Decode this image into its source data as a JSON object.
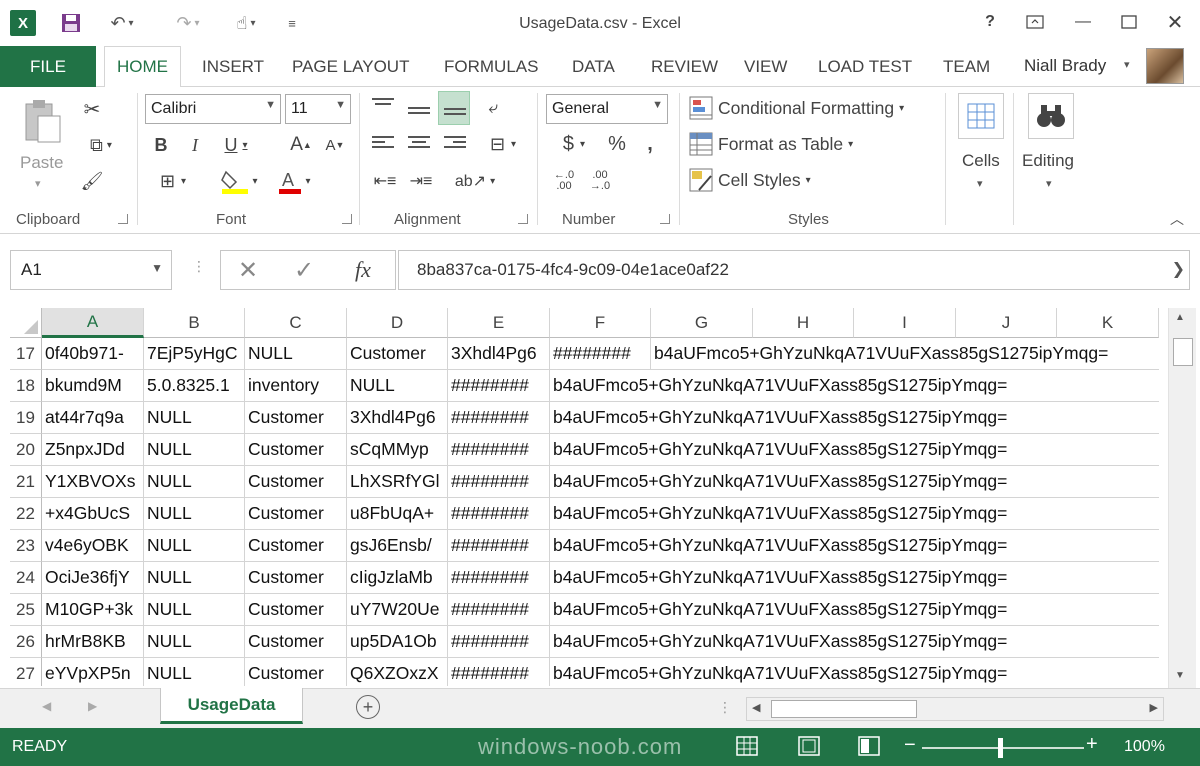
{
  "window": {
    "title": "UsageData.csv - Excel"
  },
  "colors": {
    "accent": "#217346",
    "selection": "#217346"
  },
  "icons": {
    "app": "excel-logo-icon",
    "save": "save-icon",
    "undo": "undo-icon",
    "redo": "redo-icon",
    "touch": "touch-mode-icon",
    "customize": "customize-qat-icon"
  },
  "ribbon_tabs": {
    "file": "FILE",
    "items": [
      "HOME",
      "INSERT",
      "PAGE LAYOUT",
      "FORMULAS",
      "DATA",
      "REVIEW",
      "VIEW",
      "LOAD TEST",
      "TEAM"
    ],
    "active": "HOME"
  },
  "user": {
    "name": "Niall Brady"
  },
  "ribbon": {
    "clipboard": {
      "label": "Clipboard",
      "paste": "Paste"
    },
    "font": {
      "label": "Font",
      "family": "Calibri",
      "size": "11"
    },
    "alignment": {
      "label": "Alignment"
    },
    "number": {
      "label": "Number",
      "format": "General"
    },
    "styles": {
      "label": "Styles",
      "conditional_formatting": "Conditional Formatting",
      "format_as_table": "Format as Table",
      "cell_styles": "Cell Styles"
    },
    "cells": {
      "label": "Cells"
    },
    "editing": {
      "label": "Editing"
    }
  },
  "formula_bar": {
    "name_box": "A1",
    "fx": "fx",
    "value": "8ba837ca-0175-4fc4-9c09-04e1ace0af22"
  },
  "grid": {
    "columns": [
      "A",
      "B",
      "C",
      "D",
      "E",
      "F",
      "G",
      "H",
      "I",
      "J",
      "K"
    ],
    "selected_column": "A",
    "rows": [
      {
        "num": "17",
        "cells": [
          "0f40b971-",
          "7EjP5yHgC",
          "NULL",
          "Customer",
          "3Xhdl4Pg6",
          "########",
          "b4aUFmco5+GhYzuNkqA71VUuFXass85gS1275ipYmqg="
        ]
      },
      {
        "num": "18",
        "cells": [
          "bkumd9M",
          "5.0.8325.1",
          "inventory",
          "NULL",
          "########",
          "b4aUFmco5+GhYzuNkqA71VUuFXass85gS1275ipYmqg="
        ]
      },
      {
        "num": "19",
        "cells": [
          "at44r7q9a",
          "NULL",
          "Customer",
          "3Xhdl4Pg6",
          "########",
          "b4aUFmco5+GhYzuNkqA71VUuFXass85gS1275ipYmqg="
        ]
      },
      {
        "num": "20",
        "cells": [
          "Z5npxJDd",
          "NULL",
          "Customer",
          "sCqMMyp",
          "########",
          "b4aUFmco5+GhYzuNkqA71VUuFXass85gS1275ipYmqg="
        ]
      },
      {
        "num": "21",
        "cells": [
          "Y1XBVOXs",
          "NULL",
          "Customer",
          "LhXSRfYGl",
          "########",
          "b4aUFmco5+GhYzuNkqA71VUuFXass85gS1275ipYmqg="
        ]
      },
      {
        "num": "22",
        "cells": [
          "+x4GbUcS",
          "NULL",
          "Customer",
          "u8FbUqA+",
          "########",
          "b4aUFmco5+GhYzuNkqA71VUuFXass85gS1275ipYmqg="
        ]
      },
      {
        "num": "23",
        "cells": [
          "v4e6yOBK",
          "NULL",
          "Customer",
          "gsJ6Ensb/",
          "########",
          "b4aUFmco5+GhYzuNkqA71VUuFXass85gS1275ipYmqg="
        ]
      },
      {
        "num": "24",
        "cells": [
          "OciJe36fjY",
          "NULL",
          "Customer",
          "cIigJzlaMb",
          "########",
          "b4aUFmco5+GhYzuNkqA71VUuFXass85gS1275ipYmqg="
        ]
      },
      {
        "num": "25",
        "cells": [
          "M10GP+3k",
          "NULL",
          "Customer",
          "uY7W20Ue",
          "########",
          "b4aUFmco5+GhYzuNkqA71VUuFXass85gS1275ipYmqg="
        ]
      },
      {
        "num": "26",
        "cells": [
          "hrMrB8KB",
          "NULL",
          "Customer",
          "up5DA1Ob",
          "########",
          "b4aUFmco5+GhYzuNkqA71VUuFXass85gS1275ipYmqg="
        ]
      },
      {
        "num": "27",
        "cells": [
          "eYVpXP5n",
          "NULL",
          "Customer",
          "Q6XZOxzX",
          "########",
          "b4aUFmco5+GhYzuNkqA71VUuFXass85gS1275ipYmqg="
        ]
      }
    ]
  },
  "sheets": {
    "active": "UsageData"
  },
  "status": {
    "ready": "READY",
    "watermark": "windows-noob.com",
    "zoom": "100%"
  }
}
